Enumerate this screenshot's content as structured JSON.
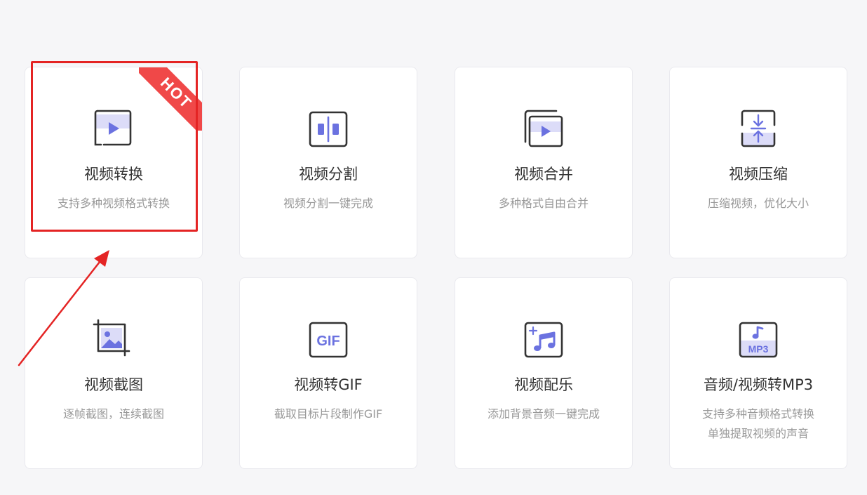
{
  "hot_badge": "HOT",
  "colors": {
    "accent": "#6b72e0",
    "icon_stroke": "#333333",
    "hot": "#f04848",
    "highlight": "#e42424"
  },
  "tools": [
    {
      "title": "视频转换",
      "desc": "支持多种视频格式转换",
      "icon": "video-convert-icon"
    },
    {
      "title": "视频分割",
      "desc": "视频分割一键完成",
      "icon": "video-split-icon"
    },
    {
      "title": "视频合并",
      "desc": "多种格式自由合并",
      "icon": "video-merge-icon"
    },
    {
      "title": "视频压缩",
      "desc": "压缩视频，优化大小",
      "icon": "video-compress-icon"
    },
    {
      "title": "视频截图",
      "desc": "逐帧截图，连续截图",
      "icon": "video-screenshot-icon"
    },
    {
      "title": "视频转GIF",
      "desc": "截取目标片段制作GIF",
      "icon": "video-to-gif-icon",
      "icon_text": "GIF"
    },
    {
      "title": "视频配乐",
      "desc": "添加背景音频一键完成",
      "icon": "video-music-icon"
    },
    {
      "title": "音频/视频转MP3",
      "desc": "支持多种音频格式转换",
      "desc2": "单独提取视频的声音",
      "icon": "audio-to-mp3-icon",
      "icon_text": "MP3"
    }
  ]
}
